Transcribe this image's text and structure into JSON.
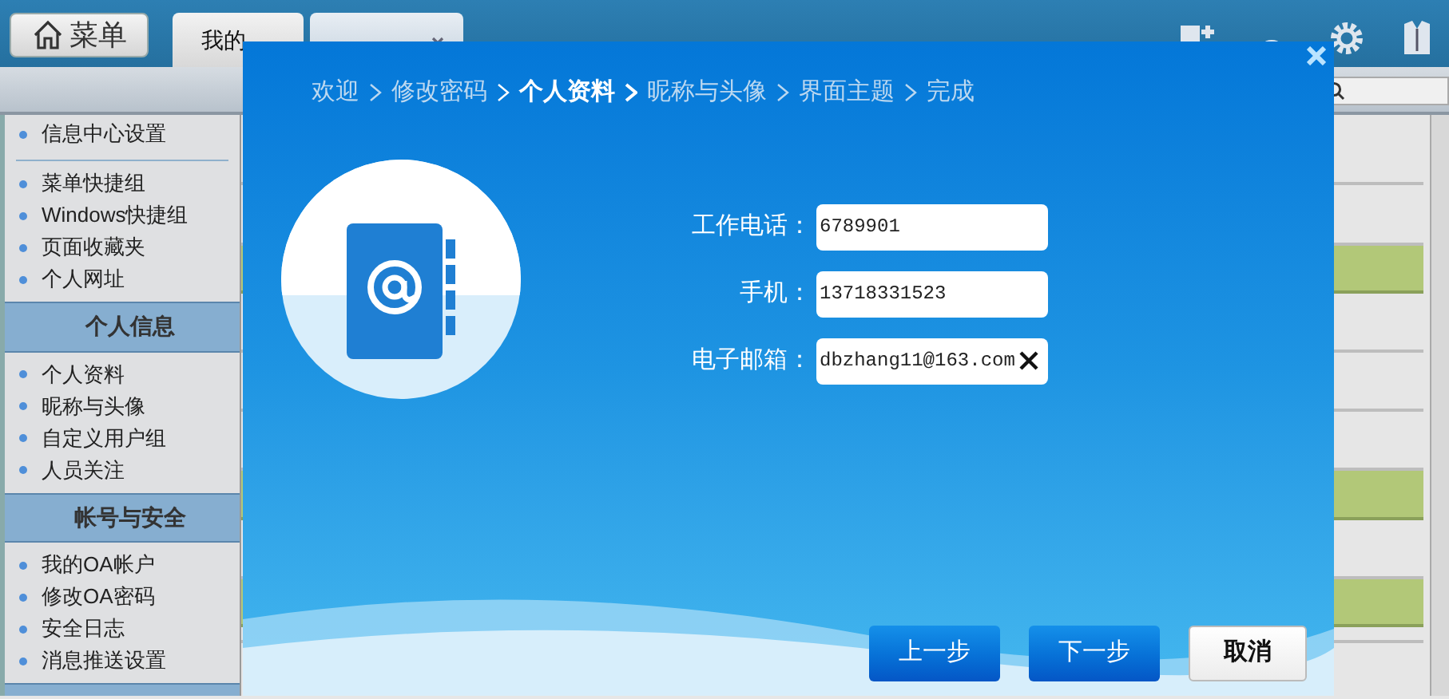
{
  "menu_button": {
    "label": "菜单"
  },
  "tabs": [
    {
      "label": "我的",
      "selected": false,
      "closable": false
    },
    {
      "selected": true,
      "closable": true
    }
  ],
  "sidebar": {
    "groups": [
      {
        "items": [
          "信息中心设置"
        ]
      },
      {
        "items": [
          "菜单快捷组",
          "Windows快捷组",
          "页面收藏夹",
          "个人网址"
        ]
      },
      {
        "title": "个人信息",
        "items": [
          "个人资料",
          "昵称与头像",
          "自定义用户组",
          "人员关注"
        ]
      },
      {
        "title": "帐号与安全",
        "items": [
          "我的OA帐户",
          "修改OA密码",
          "安全日志",
          "消息推送设置"
        ]
      }
    ]
  },
  "grid_rows": [
    {
      "highlighted": false
    },
    {
      "highlighted": false
    },
    {
      "highlighted": true
    },
    {
      "highlighted": false
    },
    {
      "highlighted": false
    },
    {
      "highlighted": false
    },
    {
      "highlighted": true
    },
    {
      "highlighted": false
    },
    {
      "highlighted": true
    },
    {
      "highlighted": false
    }
  ],
  "dialog": {
    "steps": [
      {
        "label": "欢迎",
        "selected": false
      },
      {
        "label": "修改密码",
        "selected": false
      },
      {
        "label": "个人资料",
        "selected": true
      },
      {
        "label": "昵称与头像",
        "selected": false
      },
      {
        "label": "界面主题",
        "selected": false
      },
      {
        "label": "完成",
        "selected": false
      }
    ],
    "fields": [
      {
        "label": "工作电话：",
        "value": "6789901",
        "clearable": false
      },
      {
        "label": "手机：",
        "value": "13718331523",
        "clearable": false
      },
      {
        "label": "电子邮箱：",
        "value": "dbzhang11@163.com",
        "clearable": true
      }
    ],
    "buttons": [
      {
        "label": "上一步",
        "kind": "primary"
      },
      {
        "label": "下一步",
        "kind": "primary"
      },
      {
        "label": "取消",
        "kind": "secondary"
      }
    ]
  }
}
